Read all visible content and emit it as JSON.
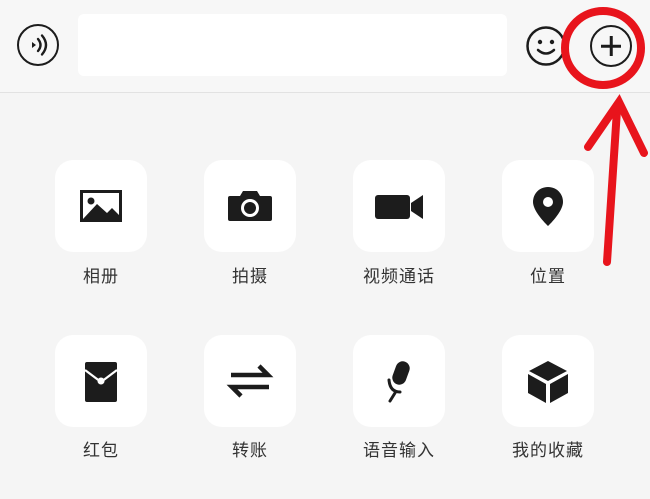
{
  "input_bar": {
    "voice_icon": "voice-icon",
    "input_value": "",
    "emoji_icon": "emoji-icon",
    "more_icon": "plus-icon"
  },
  "panel": {
    "items": [
      {
        "label": "相册",
        "icon": "image-icon"
      },
      {
        "label": "拍摄",
        "icon": "camera-icon"
      },
      {
        "label": "视频通话",
        "icon": "video-call-icon"
      },
      {
        "label": "位置",
        "icon": "location-pin-icon"
      },
      {
        "label": "红包",
        "icon": "red-packet-icon"
      },
      {
        "label": "转账",
        "icon": "transfer-arrows-icon"
      },
      {
        "label": "语音输入",
        "icon": "microphone-icon"
      },
      {
        "label": "我的收藏",
        "icon": "favorites-cube-icon"
      }
    ]
  },
  "annotation": {
    "color": "#e8141c"
  }
}
